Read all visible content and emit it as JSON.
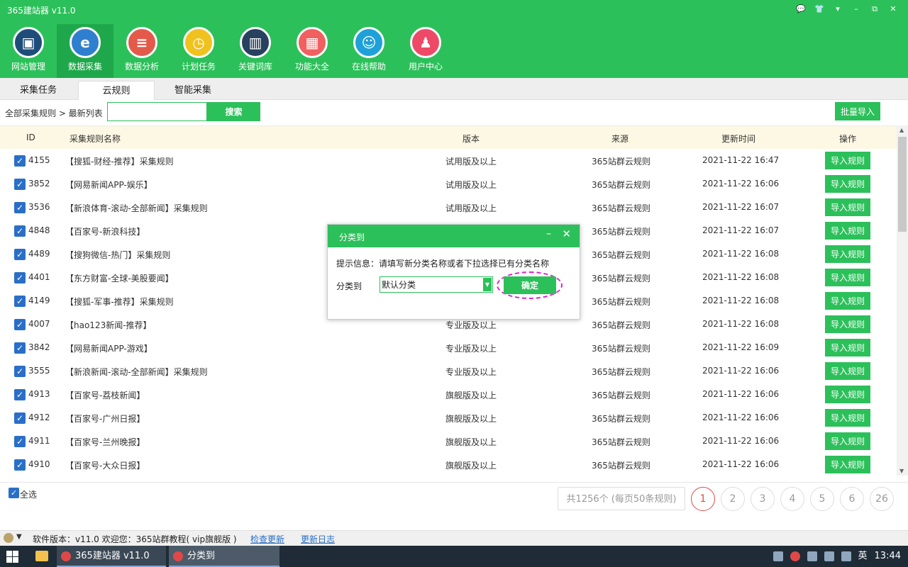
{
  "app": {
    "title": "365建站器 v11.0",
    "window_controls": [
      "💬",
      "👕",
      "▾",
      "–",
      "⧉",
      "✕"
    ]
  },
  "toolbar": [
    {
      "label": "网站管理",
      "icon": "monitor-icon",
      "color": "#1e4d7a",
      "glyph": "▣"
    },
    {
      "label": "数据采集",
      "icon": "edge-icon",
      "color": "#2f7fcf",
      "glyph": "e",
      "active": true
    },
    {
      "label": "数据分析",
      "icon": "database-icon",
      "color": "#e35a4a",
      "glyph": "≡"
    },
    {
      "label": "计划任务",
      "icon": "clock-icon",
      "color": "#f0c21f",
      "glyph": "◷"
    },
    {
      "label": "关键词库",
      "icon": "book-icon",
      "color": "#27415f",
      "glyph": "▥"
    },
    {
      "label": "功能大全",
      "icon": "grid-icon",
      "color": "#f06060",
      "glyph": "▦"
    },
    {
      "label": "在线帮助",
      "icon": "headset-icon",
      "color": "#1ea1d8",
      "glyph": "☺"
    },
    {
      "label": "用户中心",
      "icon": "user-icon",
      "color": "#ee4a68",
      "glyph": "♟"
    }
  ],
  "tabs": [
    {
      "label": "采集任务",
      "active": false
    },
    {
      "label": "云规则",
      "active": true
    },
    {
      "label": "智能采集",
      "active": false
    }
  ],
  "search": {
    "breadcrumb": "全部采集规则 > 最新列表",
    "placeholder": "",
    "button": "搜索",
    "bulk_import": "批量导入"
  },
  "table": {
    "headers": {
      "id": "ID",
      "name": "采集规则名称",
      "version": "版本",
      "source": "来源",
      "updated": "更新时间",
      "action": "操作"
    },
    "rows": [
      {
        "id": "4155",
        "name": "【搜狐-财经-推荐】采集规则",
        "version": "试用版及以上",
        "source": "365站群云规则",
        "updated": "2021-11-22 16:47",
        "action": "导入规则"
      },
      {
        "id": "3852",
        "name": "【网易新闻APP-娱乐】",
        "version": "试用版及以上",
        "source": "365站群云规则",
        "updated": "2021-11-22 16:06",
        "action": "导入规则"
      },
      {
        "id": "3536",
        "name": "【新浪体育-滚动-全部新闻】采集规则",
        "version": "试用版及以上",
        "source": "365站群云规则",
        "updated": "2021-11-22 16:07",
        "action": "导入规则"
      },
      {
        "id": "4848",
        "name": "【百家号-新浪科技】",
        "version": "",
        "source": "365站群云规则",
        "updated": "2021-11-22 16:07",
        "action": "导入规则"
      },
      {
        "id": "4489",
        "name": "【搜狗微信-热门】采集规则",
        "version": "",
        "source": "365站群云规则",
        "updated": "2021-11-22 16:08",
        "action": "导入规则"
      },
      {
        "id": "4401",
        "name": "【东方财富-全球-美股要闻】",
        "version": "",
        "source": "365站群云规则",
        "updated": "2021-11-22 16:08",
        "action": "导入规则"
      },
      {
        "id": "4149",
        "name": "【搜狐-军事-推荐】采集规则",
        "version": "",
        "source": "365站群云规则",
        "updated": "2021-11-22 16:08",
        "action": "导入规则"
      },
      {
        "id": "4007",
        "name": "【hao123新闻-推荐】",
        "version": "专业版及以上",
        "source": "365站群云规则",
        "updated": "2021-11-22 16:08",
        "action": "导入规则"
      },
      {
        "id": "3842",
        "name": "【网易新闻APP-游戏】",
        "version": "专业版及以上",
        "source": "365站群云规则",
        "updated": "2021-11-22 16:09",
        "action": "导入规则"
      },
      {
        "id": "3555",
        "name": "【新浪新闻-滚动-全部新闻】采集规则",
        "version": "专业版及以上",
        "source": "365站群云规则",
        "updated": "2021-11-22 16:06",
        "action": "导入规则"
      },
      {
        "id": "4913",
        "name": "【百家号-荔枝新闻】",
        "version": "旗舰版及以上",
        "source": "365站群云规则",
        "updated": "2021-11-22 16:06",
        "action": "导入规则"
      },
      {
        "id": "4912",
        "name": "【百家号-广州日报】",
        "version": "旗舰版及以上",
        "source": "365站群云规则",
        "updated": "2021-11-22 16:06",
        "action": "导入规则"
      },
      {
        "id": "4911",
        "name": "【百家号-兰州晚报】",
        "version": "旗舰版及以上",
        "source": "365站群云规则",
        "updated": "2021-11-22 16:06",
        "action": "导入规则"
      },
      {
        "id": "4910",
        "name": "【百家号-大众日报】",
        "version": "旗舰版及以上",
        "source": "365站群云规则",
        "updated": "2021-11-22 16:06",
        "action": "导入规则"
      }
    ]
  },
  "footer": {
    "select_all": "全选",
    "total": "共1256个 (每页50条规则)",
    "pages": [
      "1",
      "2",
      "3",
      "4",
      "5",
      "6",
      "26"
    ],
    "current_page": "1"
  },
  "status": {
    "text": "软件版本：v11.0  欢迎您：365站群教程( vip旗舰版 )",
    "check_update": "检查更新",
    "changelog": "更新日志"
  },
  "taskbar": {
    "tasks": [
      "365建站器 v11.0",
      "分类到"
    ],
    "lang": "英",
    "time": "13:44"
  },
  "dialog": {
    "title": "分类到",
    "tip": "提示信息：请填写新分类名称或者下拉选择已有分类名称",
    "label": "分类到",
    "select_value": "默认分类",
    "ok": "确定"
  }
}
